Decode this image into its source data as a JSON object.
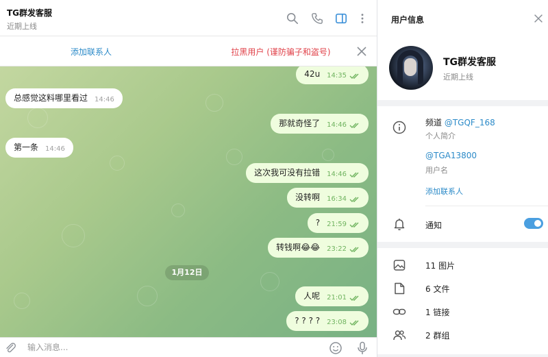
{
  "chat": {
    "title": "TG群发客服",
    "status": "近期上线",
    "add_contact": "添加联系人",
    "block_user": "拉黑用户 (谨防骗子和盗号)",
    "messages": [
      {
        "dir": "out",
        "text": "42u",
        "time": "14:35"
      },
      {
        "dir": "in",
        "text": "总感觉这料哪里看过",
        "time": "14:46"
      },
      {
        "dir": "out",
        "text": "那就奇怪了",
        "time": "14:46"
      },
      {
        "dir": "in",
        "text": "第一条",
        "time": "14:46"
      },
      {
        "dir": "out",
        "text": "这次我可没有拉错",
        "time": "14:46"
      },
      {
        "dir": "out",
        "text": "没转啊",
        "time": "16:34"
      },
      {
        "dir": "out",
        "text": "?",
        "time": "21:59"
      },
      {
        "dir": "out",
        "text": "转钱啊😂😂",
        "time": "23:22"
      },
      {
        "dir": "out",
        "text": "人呢",
        "time": "21:01"
      },
      {
        "dir": "out",
        "text": "? ? ? ?",
        "time": "23:08"
      }
    ],
    "date_separator": "1月12日",
    "input_placeholder": "输入消息..."
  },
  "info": {
    "title": "用户信息",
    "name": "TG群发客服",
    "status": "近期上线",
    "bio_prefix": "频道",
    "bio_link": "@TGQF_168",
    "bio_label": "个人简介",
    "username": "@TGA13800",
    "username_label": "用户名",
    "add_contact": "添加联系人",
    "notifications_label": "通知",
    "notifications_on": true,
    "media": [
      {
        "icon": "image-icon",
        "label": "11 图片"
      },
      {
        "icon": "file-icon",
        "label": "6 文件"
      },
      {
        "icon": "link-icon",
        "label": "1 链接"
      },
      {
        "icon": "group-icon",
        "label": "2 群组"
      }
    ]
  },
  "colors": {
    "accent": "#2b8ac8",
    "danger": "#e0424a",
    "outgoing_bubble": "#effdde",
    "toggle": "#4a9fe0"
  }
}
